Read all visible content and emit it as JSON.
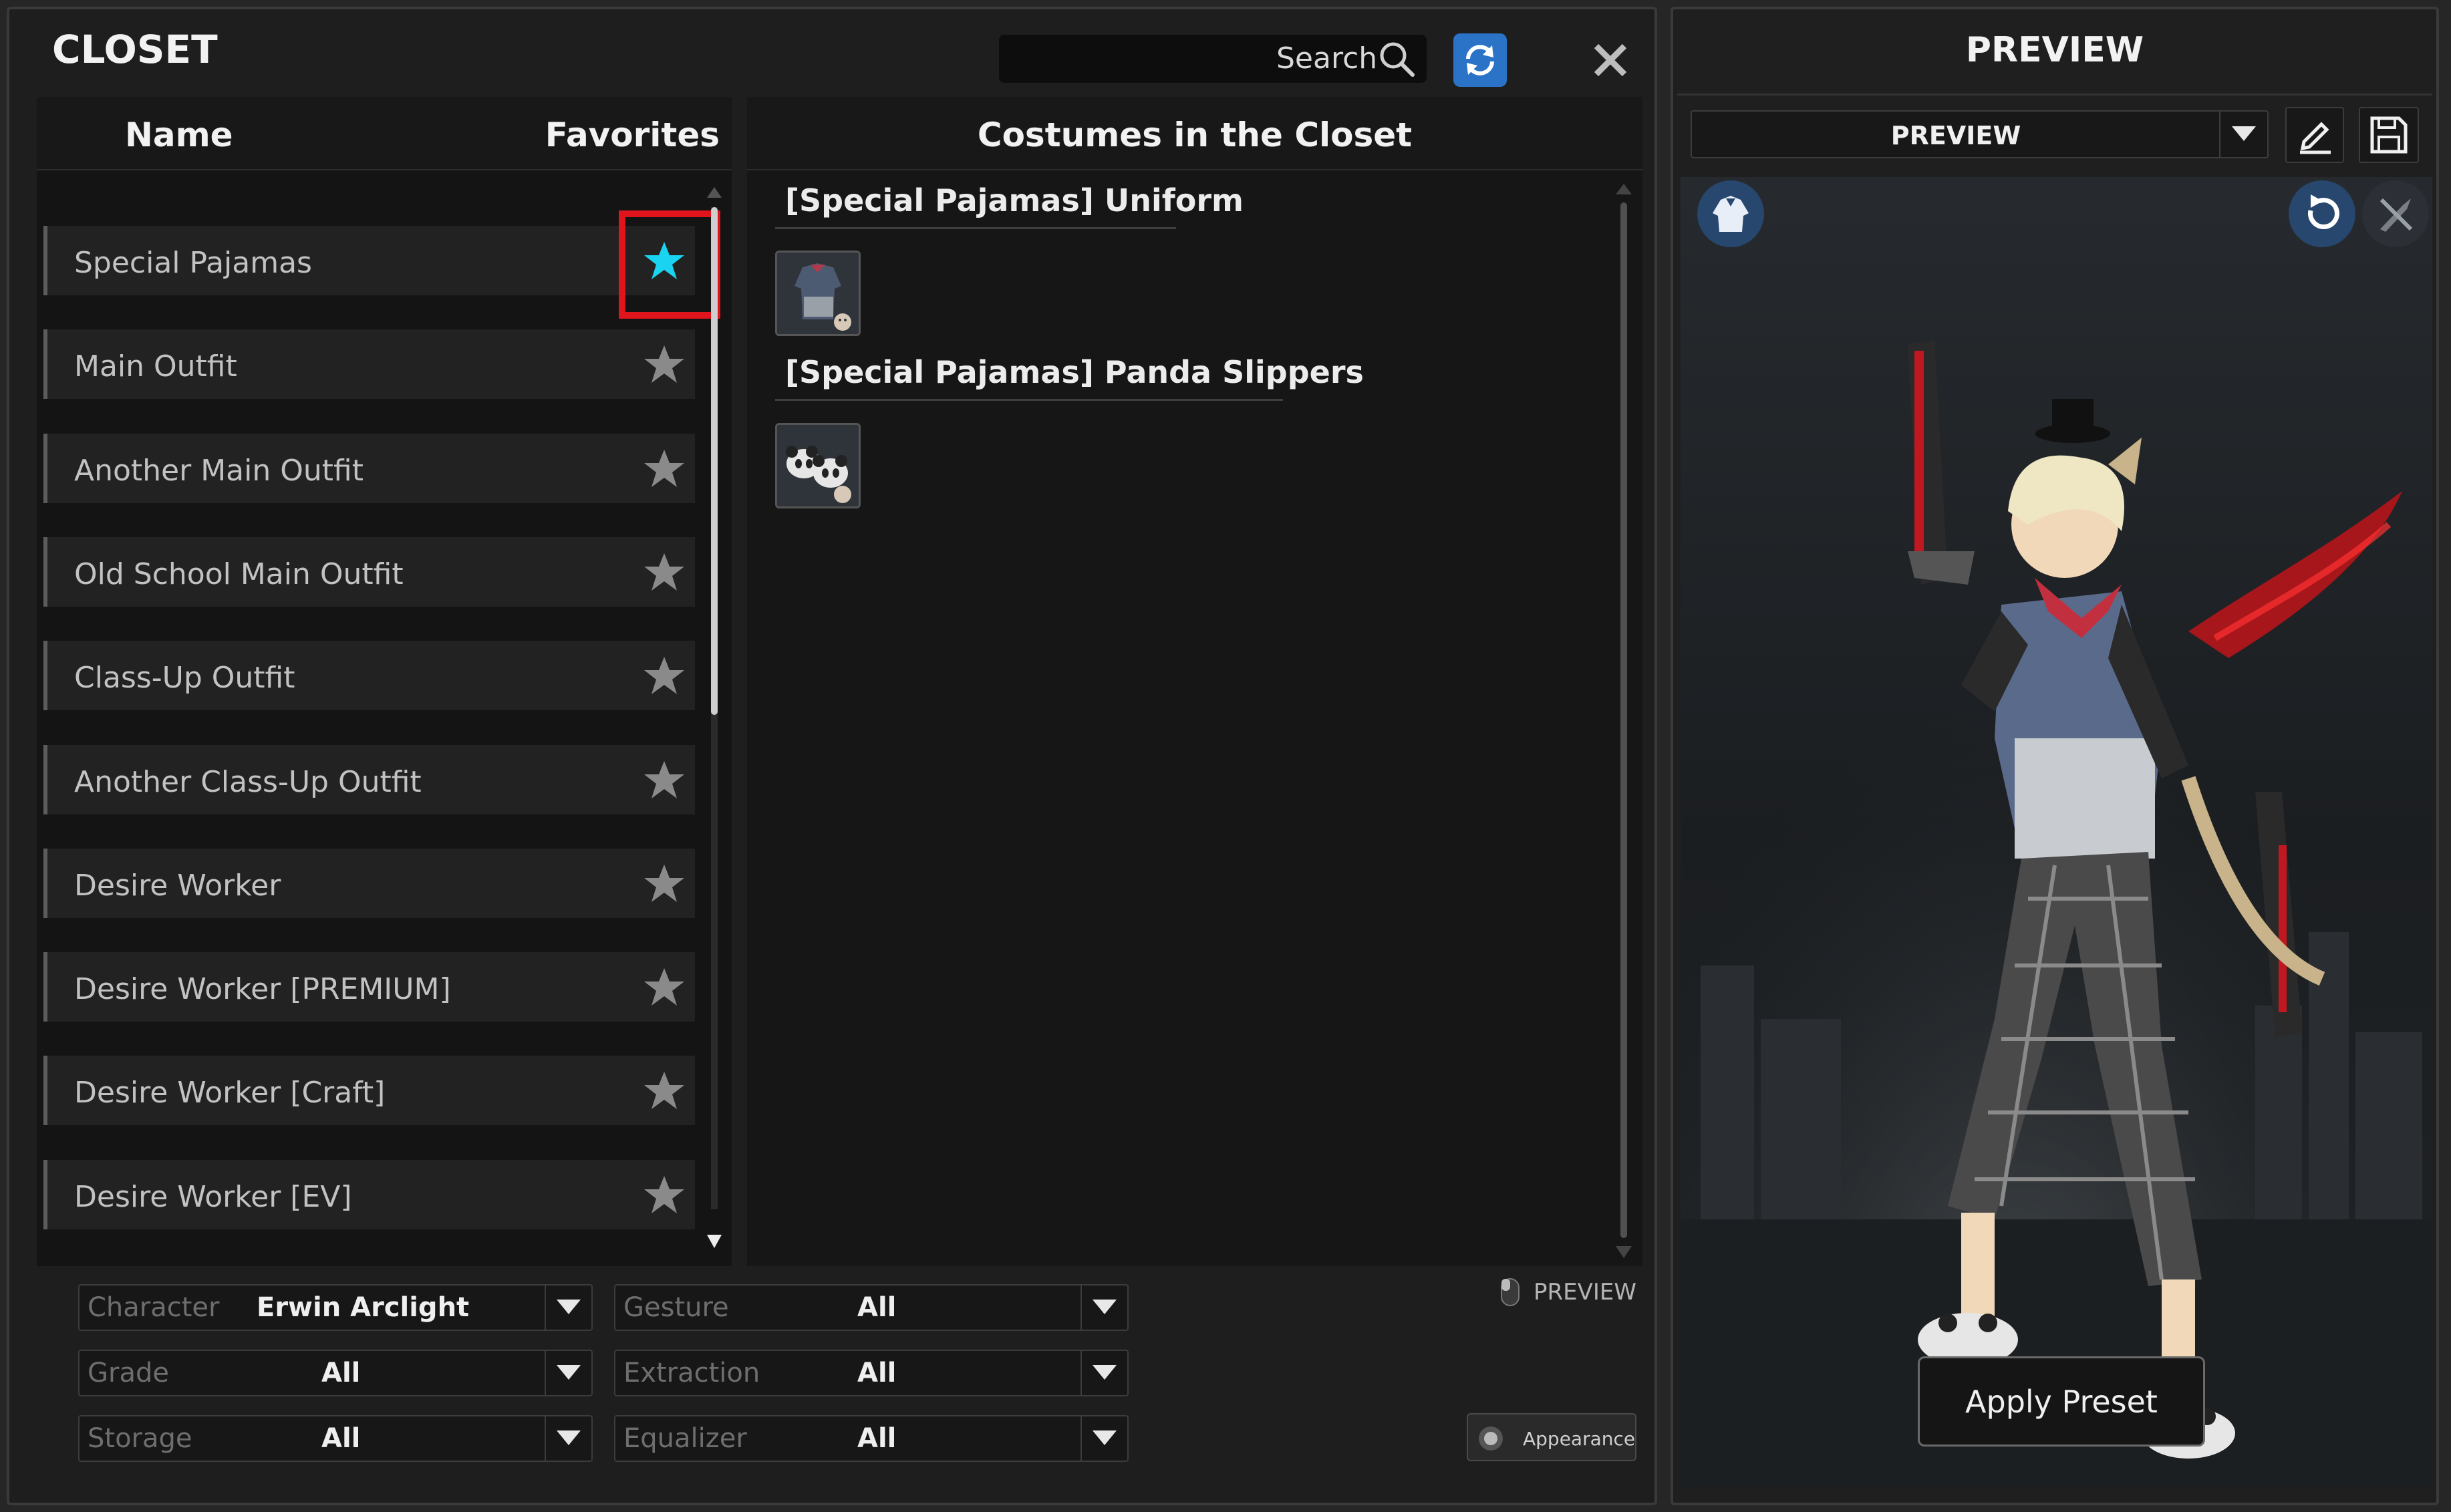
{
  "closet": {
    "title": "CLOSET",
    "search_placeholder": "Search",
    "columns": {
      "name": "Name",
      "favorites": "Favorites",
      "costumes": "Costumes in the Closet"
    },
    "outfits": [
      {
        "label": "Special Pajamas",
        "favorite": true
      },
      {
        "label": "Main Outfit",
        "favorite": false
      },
      {
        "label": "Another Main Outfit",
        "favorite": false
      },
      {
        "label": "Old School Main Outfit",
        "favorite": false
      },
      {
        "label": "Class-Up Outfit",
        "favorite": false
      },
      {
        "label": "Another Class-Up Outfit",
        "favorite": false
      },
      {
        "label": "Desire Worker",
        "favorite": false
      },
      {
        "label": "Desire Worker [PREMIUM]",
        "favorite": false
      },
      {
        "label": "Desire Worker [Craft]",
        "favorite": false
      },
      {
        "label": "Desire Worker [EV]",
        "favorite": false
      }
    ],
    "costumes": [
      {
        "title": "[Special Pajamas] Uniform",
        "icon": "pajama-top-icon"
      },
      {
        "title": "[Special Pajamas] Panda Slippers",
        "icon": "panda-slippers-icon"
      }
    ],
    "filters": {
      "character": {
        "label": "Character",
        "value": "Erwin Arclight"
      },
      "gesture": {
        "label": "Gesture",
        "value": "All"
      },
      "grade": {
        "label": "Grade",
        "value": "All"
      },
      "extraction": {
        "label": "Extraction",
        "value": "All"
      },
      "storage": {
        "label": "Storage",
        "value": "All"
      },
      "equalizer": {
        "label": "Equalizer",
        "value": "All"
      }
    },
    "preview_toggle_label": "PREVIEW",
    "appearance_button_label": "Appearance"
  },
  "preview": {
    "title": "PREVIEW",
    "preset_select_value": "PREVIEW",
    "apply_preset_label": "Apply Preset"
  },
  "colors": {
    "accent_blue": "#2b73c6",
    "favorite_star": "#19d3f0",
    "highlight": "#e0141c"
  }
}
